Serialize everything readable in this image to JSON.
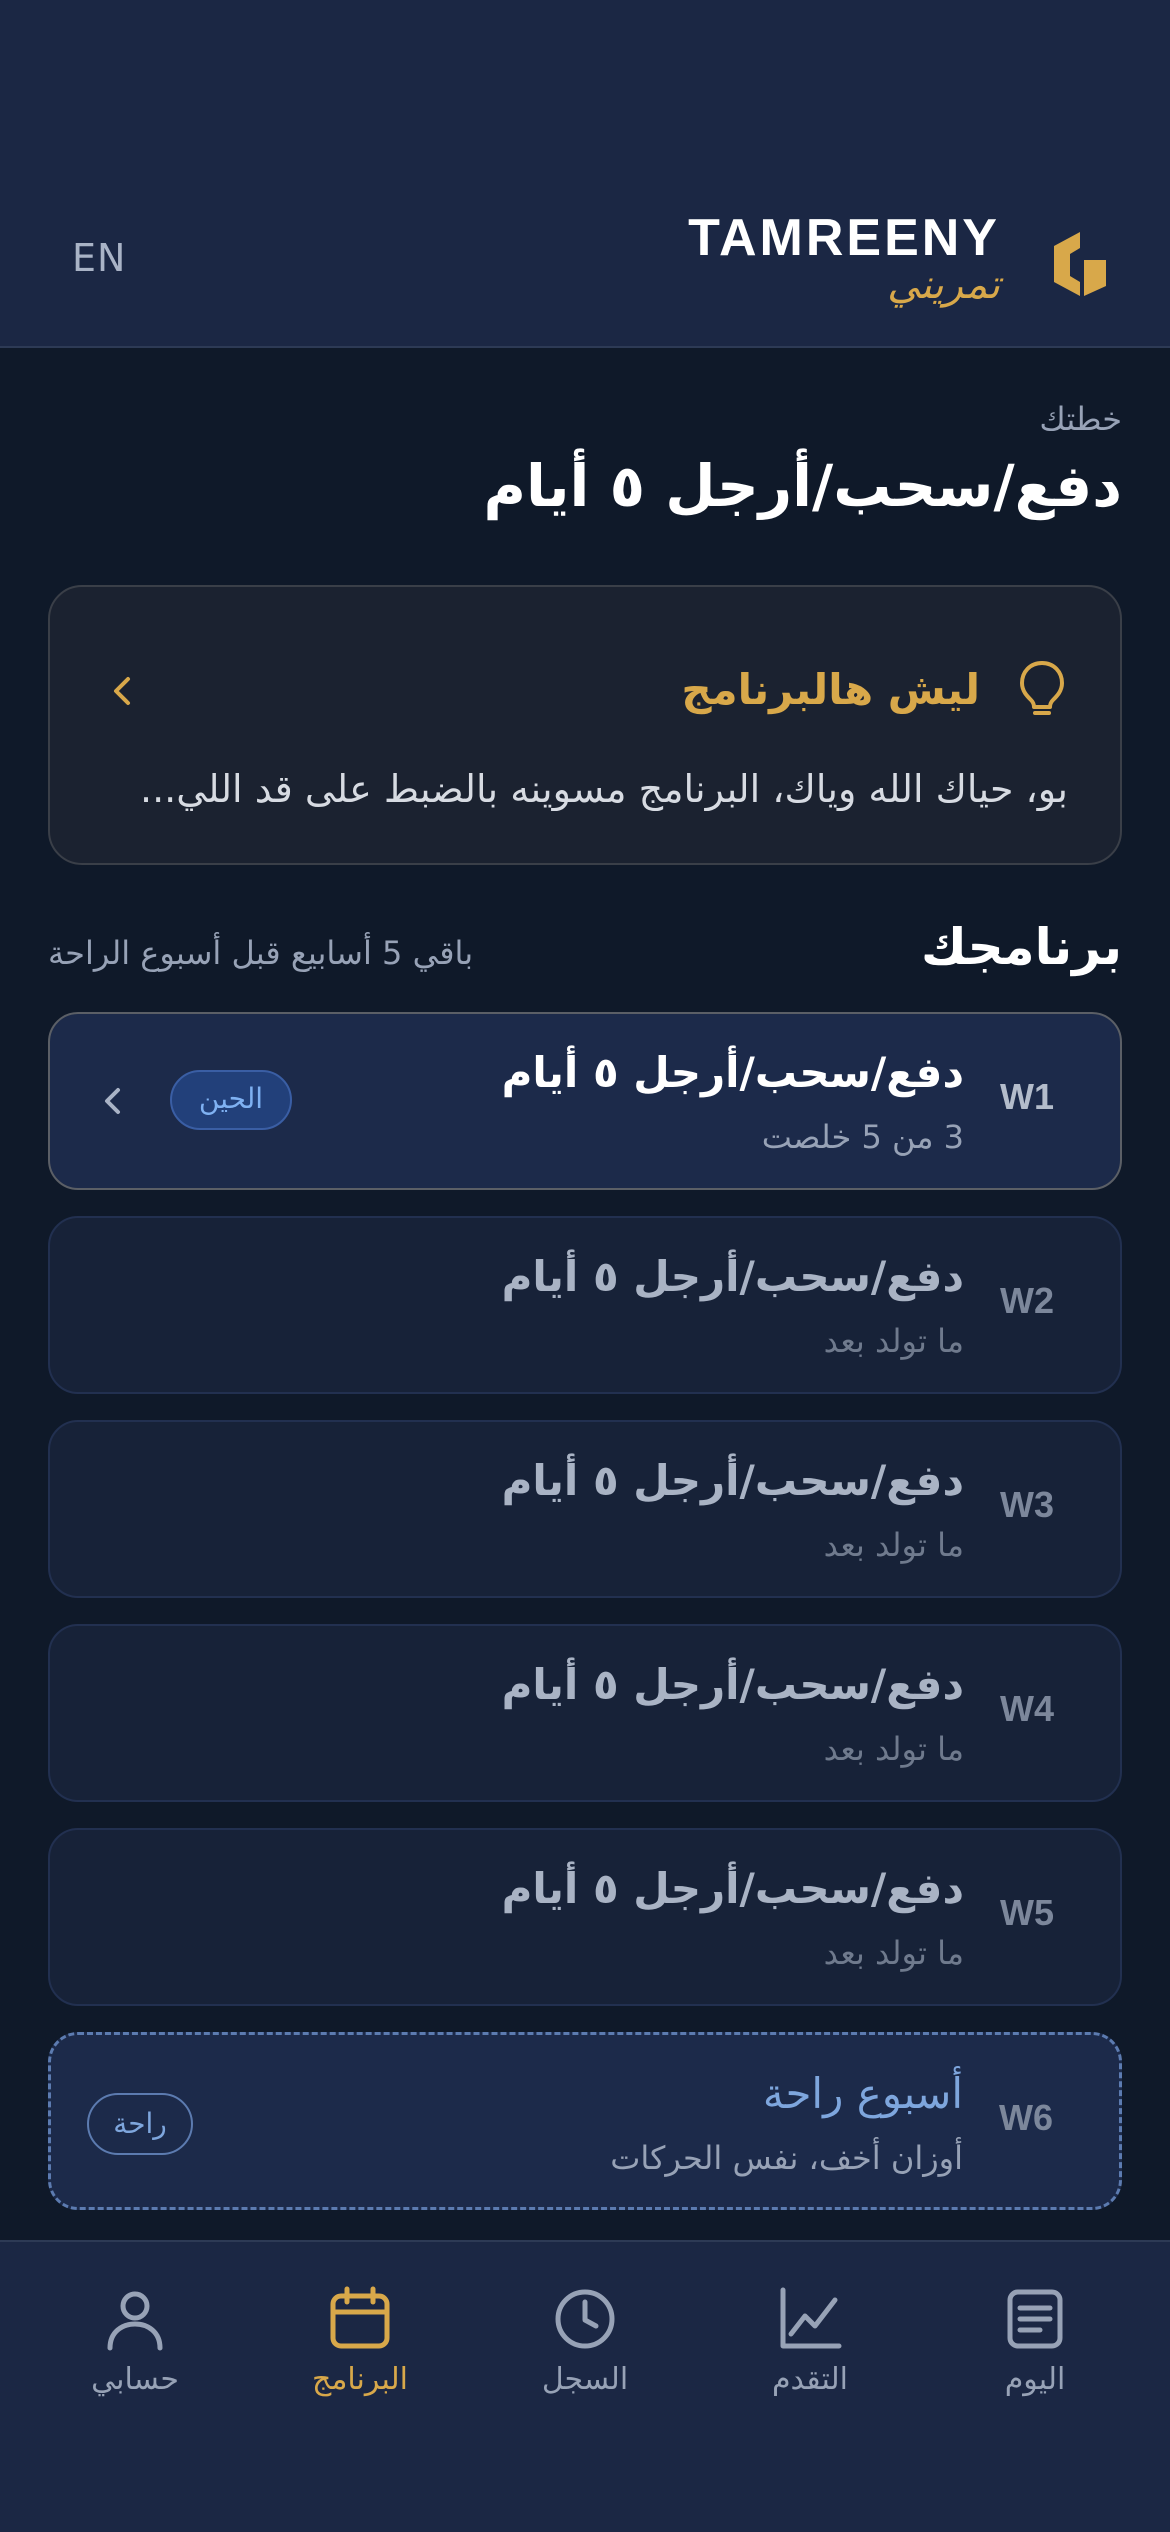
{
  "header": {
    "lang_toggle": "EN",
    "brand_name": "TAMREENY",
    "brand_arabic": "تمريني"
  },
  "plan": {
    "label": "خطتك",
    "title": "دفع/سحب/أرجل ٥ أيام"
  },
  "why_card": {
    "title": "ليش هالبرنامج",
    "body": "بو، حياك الله وياك، البرنامج مسوينه بالضبط على قد اللي..."
  },
  "program": {
    "title": "برنامجك",
    "subtitle": "باقي 5 أسابيع قبل أسبوع الراحة",
    "weeks": [
      {
        "code": "W1",
        "title": "دفع/سحب/أرجل ٥ أيام",
        "subtitle": "3 من 5 خلصت",
        "badge": "الحين"
      },
      {
        "code": "W2",
        "title": "دفع/سحب/أرجل ٥ أيام",
        "subtitle": "ما تولد بعد"
      },
      {
        "code": "W3",
        "title": "دفع/سحب/أرجل ٥ أيام",
        "subtitle": "ما تولد بعد"
      },
      {
        "code": "W4",
        "title": "دفع/سحب/أرجل ٥ أيام",
        "subtitle": "ما تولد بعد"
      },
      {
        "code": "W5",
        "title": "دفع/سحب/أرجل ٥ أيام",
        "subtitle": "ما تولد بعد"
      },
      {
        "code": "W6",
        "title": "أسبوع راحة",
        "subtitle": "أوزان أخف، نفس الحركات",
        "badge": "راحة"
      }
    ]
  },
  "nav": {
    "items": [
      {
        "label": "حسابي",
        "icon": "person-icon"
      },
      {
        "label": "البرنامج",
        "icon": "calendar-icon",
        "active": true
      },
      {
        "label": "السجل",
        "icon": "clock-icon"
      },
      {
        "label": "التقدم",
        "icon": "chart-icon"
      },
      {
        "label": "اليوم",
        "icon": "document-icon"
      }
    ]
  },
  "colors": {
    "background": "#0f1929",
    "header": "#1b2744",
    "accent_gold": "#d8a84a",
    "accent_blue": "#7fb1f2"
  }
}
